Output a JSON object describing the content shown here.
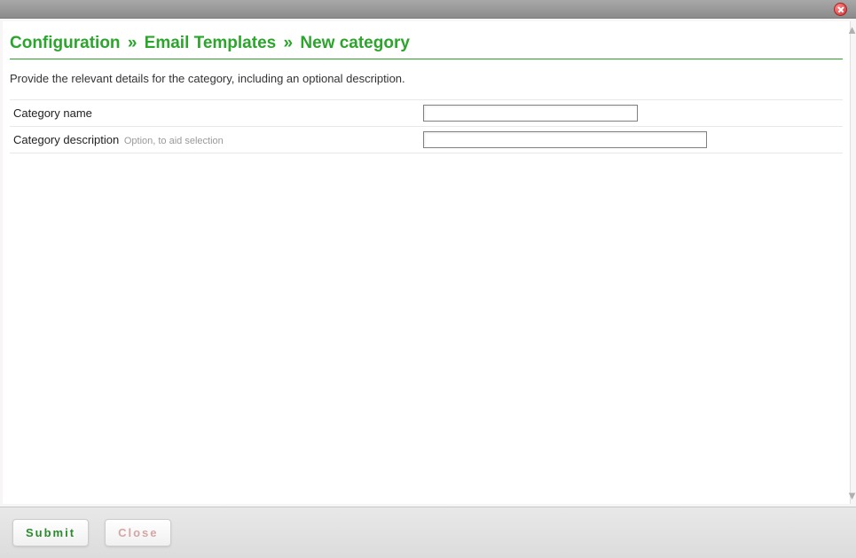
{
  "breadcrumb": {
    "part1": "Configuration",
    "sep": "»",
    "part2": "Email Templates",
    "part3": "New category"
  },
  "instruction": "Provide the relevant details for the category, including an optional description.",
  "form": {
    "name_label": "Category name",
    "name_value": "",
    "desc_label": "Category description",
    "desc_hint": "Option, to aid selection",
    "desc_value": ""
  },
  "buttons": {
    "submit": "Submit",
    "close": "Close"
  }
}
